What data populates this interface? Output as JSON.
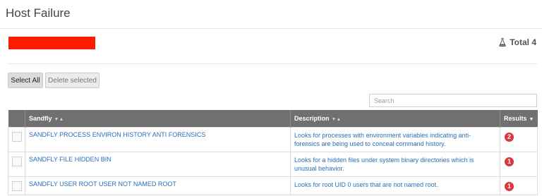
{
  "page": {
    "title": "Host Failure"
  },
  "summary": {
    "total_label": "Total 4",
    "icon": "flask-icon",
    "redaction_color": "#ff1a00"
  },
  "toolbar": {
    "select_all_label": "Select All",
    "delete_selected_label": "Delete selected"
  },
  "search": {
    "placeholder": "Search",
    "value": ""
  },
  "table": {
    "headers": {
      "sandfly": "Sandfly",
      "description": "Description",
      "results": "Results"
    },
    "rows": [
      {
        "sandfly": "SANDFLY PROCESS ENVIRON HISTORY ANTI FORENSICS",
        "description": "Looks for processes with environment variables indicating anti-forensics are being used to conceal command history.",
        "results": "2"
      },
      {
        "sandfly": "SANDFLY FILE HIDDEN BIN",
        "description": "Looks for a hidden files under system binary directories which is unusual behavior.",
        "results": "1"
      },
      {
        "sandfly": "SANDFLY USER ROOT USER NOT NAMED ROOT",
        "description": "Looks for root UID 0 users that are not named root.",
        "results": "1"
      }
    ]
  },
  "colors": {
    "header_bg": "#707070",
    "link": "#2a6fb5",
    "badge": "#d9363e"
  }
}
